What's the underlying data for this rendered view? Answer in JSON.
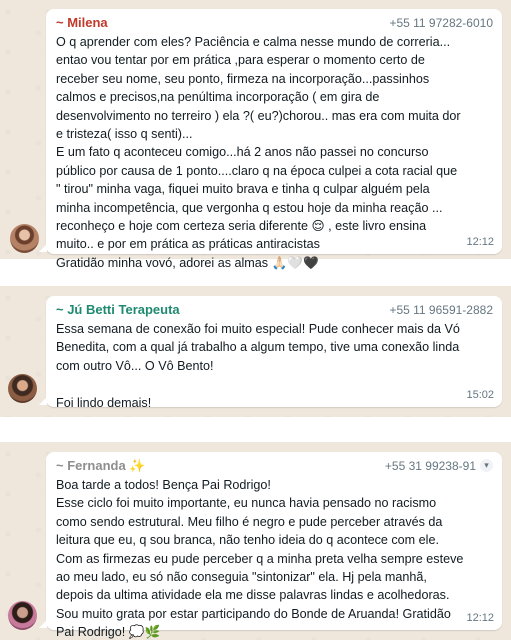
{
  "colors": {
    "sender_milena": "#c0392b",
    "sender_ju": "#1f8a70",
    "sender_fernanda": "#8e8e8e",
    "chat_background": "#efe7dc",
    "bubble": "#ffffff"
  },
  "messages": [
    {
      "sender": "~ Milena",
      "phone": "+55 11 97282-6010",
      "text": "O q aprender com eles? Paciência e calma nesse mundo de correria...\nentao vou tentar por em prática ,para esperar o momento certo de\nreceber seu nome, seu ponto, firmeza na incorporação...passinhos\ncalmos e precisos,na penúltima incorporação ( em gira de\ndesenvolvimento no terreiro ) ela ?( eu?)chorou.. mas era com muita dor\ne tristeza( isso q senti)...\nE um fato q aconteceu comigo...há 2 anos não passei no concurso\npúblico por causa de 1 ponto....claro q na época culpei a cota racial que\n\" tirou\" minha vaga, fiquei muito brava e tinha q culpar alguém pela\nminha incompetência, que vergonha q estou hoje da minha reação ...\nreconheço e hoje com certeza seria diferente 😌 , este livro ensina\nmuito.. e por em prática as práticas antiracistas\nGratidão minha vovó, adorei as almas 🙏🏻🤍🖤",
      "time": "12:12"
    },
    {
      "sender": "~ Jú Betti Terapeuta",
      "phone": "+55 11 96591-2882",
      "text": "Essa semana de conexão foi muito especial! Pude conhecer mais da Vó\nBenedita, com a qual já trabalho a algum tempo, tive uma conexão linda\ncom outro Vô... O Vô Bento!\n\nFoi lindo demais!",
      "time": "15:02"
    },
    {
      "sender": "~ Fernanda ✨",
      "phone": "+55 31 99238-91",
      "text": "Boa tarde a todos! Bença Pai Rodrigo!\nEsse ciclo foi muito importante, eu nunca havia pensado no racismo\ncomo sendo estrutural. Meu filho é negro e pude perceber através da\nleitura que eu, q sou branca, não tenho ideia do q acontece com ele.\nCom as firmezas eu pude perceber q a minha preta velha sempre esteve\nao meu lado, eu só não conseguia \"sintonizar\" ela. Hj pela manhã,\ndepois da ultima atividade ela me disse palavras lindas e acolhedoras.\nSou muito grata por estar participando do Bonde de Aruanda! Gratidão\nPai Rodrigo! 💭🌿",
      "time": "12:12"
    }
  ]
}
